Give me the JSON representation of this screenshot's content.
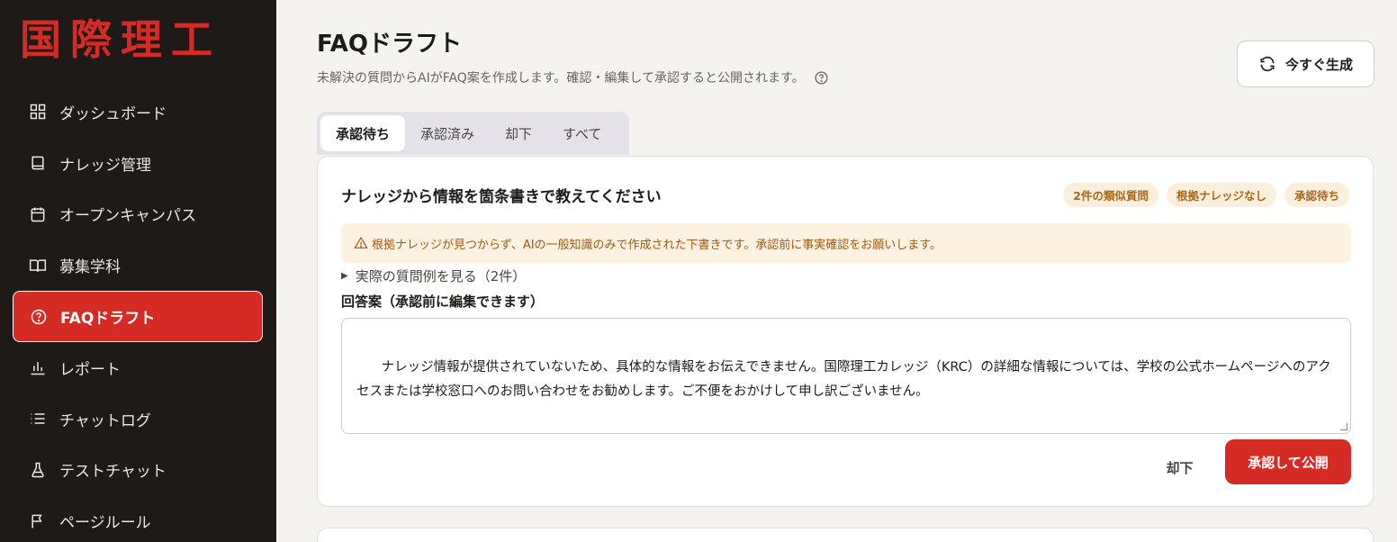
{
  "brand": {
    "logo_text": "国際理工",
    "accent": "#d42b24"
  },
  "sidebar": {
    "items": [
      {
        "label": "ダッシュボード",
        "icon": "grid-icon"
      },
      {
        "label": "ナレッジ管理",
        "icon": "book-icon"
      },
      {
        "label": "オープンキャンパス",
        "icon": "calendar-icon"
      },
      {
        "label": "募集学科",
        "icon": "open-book-icon"
      },
      {
        "label": "FAQドラフト",
        "icon": "help-circle-icon",
        "active": true
      },
      {
        "label": "レポート",
        "icon": "bar-chart-icon"
      },
      {
        "label": "チャットログ",
        "icon": "list-icon"
      },
      {
        "label": "テストチャット",
        "icon": "flask-icon"
      },
      {
        "label": "ページルール",
        "icon": "flag-icon"
      }
    ]
  },
  "header": {
    "title": "FAQドラフト",
    "subtitle": "未解決の質問からAIがFAQ案を作成します。確認・編集して承認すると公開されます。",
    "generate_label": "今すぐ生成"
  },
  "tabs": [
    {
      "label": "承認待ち",
      "active": true
    },
    {
      "label": "承認済み"
    },
    {
      "label": "却下"
    },
    {
      "label": "すべて"
    }
  ],
  "draft": {
    "question": "ナレッジから情報を箇条書きで教えてください",
    "badges": [
      "2件の類似質問",
      "根拠ナレッジなし",
      "承認待ち"
    ],
    "warning": "根拠ナレッジが見つからず、AIの一般知識のみで作成された下書きです。承認前に事実確認をお願いします。",
    "examples_toggle": "実際の質問例を見る（2件）",
    "answer_label": "回答案（承認前に編集できます）",
    "answer_text": "ナレッジ情報が提供されていないため、具体的な情報をお伝えできません。国際理工カレッジ（KRC）の詳細な情報については、学校の公式ホームページへのアクセスまたは学校窓口へのお問い合わせをお勧めします。ご不便をおかけして申し訳ございません。",
    "reject_label": "却下",
    "approve_label": "承認して公開"
  }
}
